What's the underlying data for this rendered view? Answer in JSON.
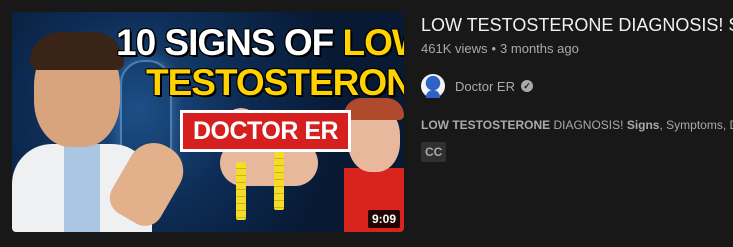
{
  "thumbnail": {
    "line1_white": "10 SIGNS OF ",
    "line1_yellow": "LOW",
    "line2": "TESTOSTERONE",
    "badge": "DOCTOR ER",
    "duration": "9:09"
  },
  "video": {
    "title": "LOW TESTOSTERONE DIAGNOSIS! Signs, Symptoms, Diagnosis & Treatment",
    "views": "461K views",
    "separator": "•",
    "age": "3 months ago"
  },
  "channel": {
    "name": "Doctor ER",
    "verified_icon": "verified-check-icon"
  },
  "description": {
    "bold_1": "LOW TESTOSTERONE",
    "text_1": " DIAGNOSIS! ",
    "bold_2": "Signs",
    "text_2": ", Symptoms, Diagnosis & Treatment"
  },
  "badges": {
    "cc": "CC"
  },
  "colors": {
    "background": "#181818",
    "thumbnail_yellow": "#ffd200",
    "badge_red": "#d61f1f"
  }
}
